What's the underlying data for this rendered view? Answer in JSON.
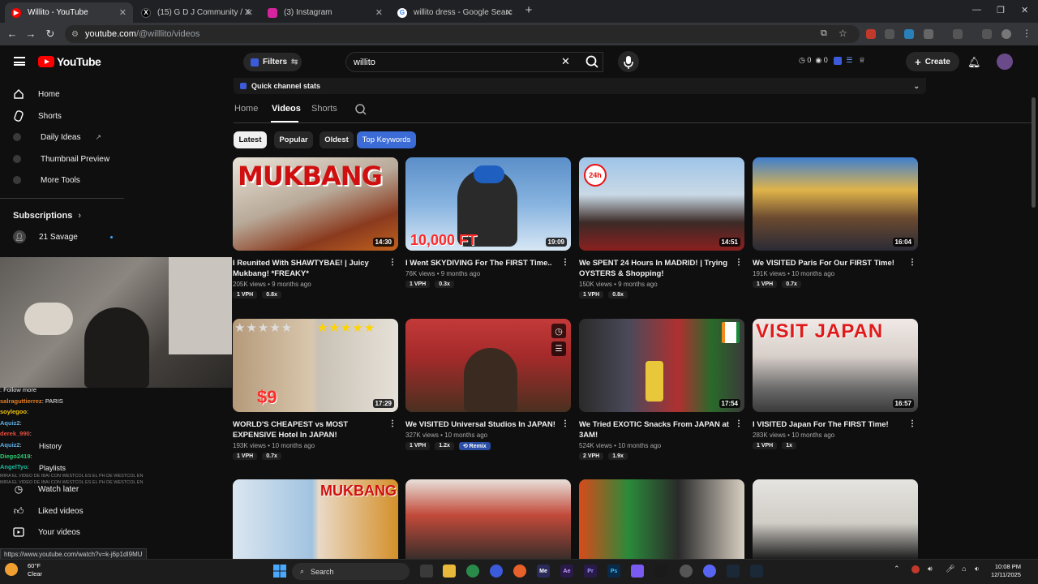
{
  "browser": {
    "tabs": [
      {
        "title": "Willito - YouTube",
        "icon": "youtube-icon",
        "color": "#ff0000"
      },
      {
        "title": "(15) G D J Community / X",
        "icon": "x-icon",
        "color": "#000000"
      },
      {
        "title": "(3) Instagram",
        "icon": "instagram-icon",
        "color": "#d6249f"
      },
      {
        "title": "willito dress - Google Search",
        "icon": "google-icon",
        "color": "#4285f4"
      }
    ],
    "url_host": "youtube.com",
    "url_path": "/@willlito/videos",
    "status_url": "https://www.youtube.com/watch?v=k-j6p1dI9MU"
  },
  "youtube": {
    "logo_text": "YouTube",
    "filters_label": "Filters",
    "search_value": "willito",
    "stats": {
      "a": "0",
      "b": "0"
    },
    "create_label": "Create"
  },
  "sidebar": {
    "items": [
      {
        "label": "Home",
        "icon": "home-icon"
      },
      {
        "label": "Shorts",
        "icon": "shorts-icon"
      },
      {
        "label": "Daily Ideas",
        "icon": "daily-ideas-icon"
      },
      {
        "label": "Thumbnail Preview",
        "icon": "thumbnail-preview-icon"
      },
      {
        "label": "More Tools",
        "icon": "more-tools-icon"
      }
    ],
    "subscriptions_label": "Subscriptions",
    "subscriptions": [
      {
        "label": "21 Savage"
      }
    ],
    "bottom_items": [
      {
        "label": "History"
      },
      {
        "label": "Playlists"
      },
      {
        "label": "Watch later"
      },
      {
        "label": "Liked videos"
      },
      {
        "label": "Your videos"
      }
    ]
  },
  "chat": [
    {
      "user": "",
      "text": ": Follow more"
    },
    {
      "user": "salraguttierrez",
      "text": ": PARIS"
    },
    {
      "user": "soylegoo",
      "text": ":"
    },
    {
      "user": "Aquiz2",
      "text": ":"
    },
    {
      "user": "derek_990",
      "text": ":"
    },
    {
      "user": "Aquiz2",
      "text": ":"
    },
    {
      "user": "Diego2419",
      "text": ":"
    },
    {
      "user": "AngelTyo",
      "text": ":"
    },
    {
      "user": "",
      "text": "MIRA EL VIDEO DE IBAI CON WESTCOL ES EL PH DE WESTCOL EN"
    },
    {
      "user": "",
      "text": "MIRA EL VIDEO DE IBAI CON WESTCOL ES EL PH DE WESTCOL EN"
    }
  ],
  "channel": {
    "quick_stats_label": "Quick channel stats",
    "tabs": [
      "Home",
      "Videos",
      "Shorts"
    ],
    "chips": [
      "Latest",
      "Popular",
      "Oldest",
      "Top Keywords"
    ]
  },
  "videos": [
    {
      "title": "I Reunited With SHAWTYBAE! | Juicy Mukbang! *FREAKY*",
      "duration": "14:30",
      "views": "205K views",
      "age": "9 months ago",
      "vph": "1 VPH",
      "ratio": "0.8x",
      "thumb_text": "MUKBANG"
    },
    {
      "title": "I Went SKYDIVING For The FIRST Time..",
      "duration": "19:09",
      "views": "76K views",
      "age": "9 months ago",
      "vph": "1 VPH",
      "ratio": "0.3x",
      "thumb_text": "10,000 FT"
    },
    {
      "title": "We SPENT 24 Hours In MADRID! | Trying OYSTERS & Shopping!",
      "duration": "14:51",
      "views": "150K views",
      "age": "9 months ago",
      "vph": "1 VPH",
      "ratio": "0.8x",
      "thumb_text": "24h"
    },
    {
      "title": "We VISITED Paris For Our FIRST Time!",
      "duration": "16:04",
      "views": "191K views",
      "age": "10 months ago",
      "vph": "1 VPH",
      "ratio": "0.7x",
      "thumb_text": ""
    },
    {
      "title": "WORLD'S CHEAPEST vs MOST EXPENSIVE Hotel In JAPAN!",
      "duration": "17:29",
      "views": "193K views",
      "age": "10 months ago",
      "vph": "1 VPH",
      "ratio": "0.7x",
      "thumb_text": "$9"
    },
    {
      "title": "We VISITED Universal Studios In JAPAN!",
      "duration": "",
      "views": "327K views",
      "age": "10 months ago",
      "vph": "1 VPH",
      "ratio": "1.2x",
      "remix": "Remix",
      "thumb_text": ""
    },
    {
      "title": "We Tried EXOTIC Snacks From JAPAN at 3AM!",
      "duration": "17:54",
      "views": "524K views",
      "age": "10 months ago",
      "vph": "2 VPH",
      "ratio": "1.9x",
      "thumb_text": ""
    },
    {
      "title": "I VISITED Japan For The FIRST Time!",
      "duration": "16:57",
      "views": "283K views",
      "age": "10 months ago",
      "vph": "1 VPH",
      "ratio": "1x",
      "thumb_text": "VISIT JAPAN"
    },
    {
      "title": "",
      "thumb_text": "MUKBANG"
    },
    {
      "title": "",
      "thumb_text": ""
    },
    {
      "title": "",
      "thumb_text": ""
    },
    {
      "title": "",
      "thumb_text": ""
    }
  ],
  "taskbar": {
    "temp": "60°F",
    "condition": "Clear",
    "search_label": "Search",
    "time": "10:08 PM",
    "date": "12/11/2025"
  }
}
